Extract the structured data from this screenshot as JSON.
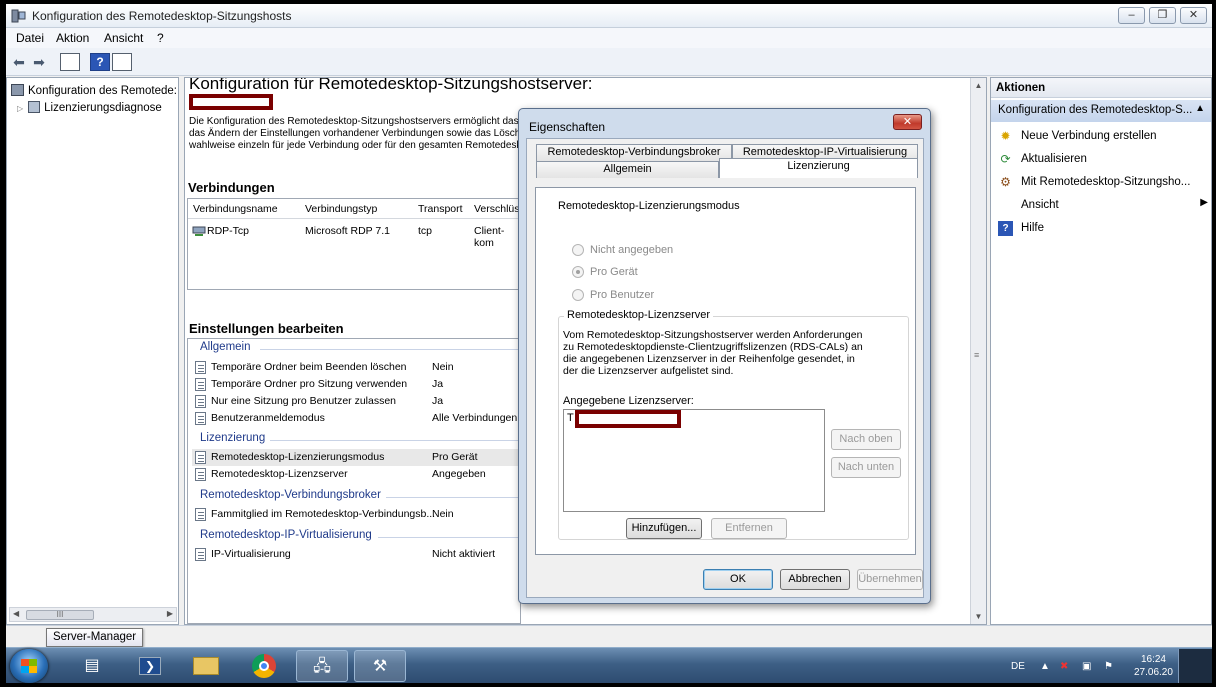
{
  "window": {
    "title": "Konfiguration des Remotedesktop-Sitzungshosts",
    "controls": {
      "minimize": "‒",
      "maximize": "❐",
      "close": "✕"
    }
  },
  "menu": [
    "Datei",
    "Aktion",
    "Ansicht",
    "?"
  ],
  "tree": {
    "root": "Konfiguration des Remotede:",
    "child": "Lizenzierungsdiagnose"
  },
  "center": {
    "title": "Konfiguration für Remotedesktop-Sitzungshostserver:",
    "description": [
      "Die Konfiguration des Remotedesktop-Sitzungshostservers ermöglicht das",
      "das Ändern der Einstellungen vorhandener Verbindungen sowie das Lösch",
      "wahlweise einzeln für jede Verbindung oder für den gesamten Remotedesk"
    ],
    "connections": {
      "heading": "Verbindungen",
      "columns": [
        "Verbindungsname",
        "Verbindungstyp",
        "Transport",
        "Verschlüss"
      ],
      "rows": [
        {
          "name": "RDP-Tcp",
          "type": "Microsoft RDP 7.1",
          "transport": "tcp",
          "encryption": "Client-kom"
        }
      ]
    },
    "settings": {
      "heading": "Einstellungen bearbeiten",
      "groups": [
        {
          "label": "Allgemein",
          "items": [
            {
              "name": "Temporäre Ordner beim Beenden löschen",
              "value": "Nein"
            },
            {
              "name": "Temporäre Ordner pro Sitzung verwenden",
              "value": "Ja"
            },
            {
              "name": "Nur eine Sitzung pro Benutzer zulassen",
              "value": "Ja"
            },
            {
              "name": "Benutzeranmeldemodus",
              "value": "Alle Verbindungen zu"
            }
          ]
        },
        {
          "label": "Lizenzierung",
          "items": [
            {
              "name": "Remotedesktop-Lizenzierungsmodus",
              "value": "Pro Gerät"
            },
            {
              "name": "Remotedesktop-Lizenzserver",
              "value": "Angegeben"
            }
          ]
        },
        {
          "label": "Remotedesktop-Verbindungsbroker",
          "items": [
            {
              "name": "Fammitglied im Remotedesktop-Verbindungsb...",
              "value": "Nein"
            }
          ]
        },
        {
          "label": "Remotedesktop-IP-Virtualisierung",
          "items": [
            {
              "name": "IP-Virtualisierung",
              "value": "Nicht aktiviert"
            }
          ]
        }
      ]
    }
  },
  "actions": {
    "title": "Aktionen",
    "section": "Konfiguration des Remotedesktop-S...",
    "items": [
      {
        "label": "Neue Verbindung erstellen",
        "icon": "new-connection-icon"
      },
      {
        "label": "Aktualisieren",
        "icon": "refresh-icon"
      },
      {
        "label": "Mit Remotedesktop-Sitzungsho...",
        "icon": "connect-icon"
      },
      {
        "label": "Ansicht",
        "icon": "none"
      },
      {
        "label": "Hilfe",
        "icon": "help-icon"
      }
    ]
  },
  "tooltip": "Server-Manager",
  "dialog": {
    "title": "Eigenschaften",
    "tabs_row1": [
      "Remotedesktop-Verbindungsbroker",
      "Remotedesktop-IP-Virtualisierung"
    ],
    "tabs_row2": [
      "Allgemein",
      "Lizenzierung"
    ],
    "active_tab": "Lizenzierung",
    "mode_label": "Remotedesktop-Lizenzierungsmodus",
    "radios": [
      {
        "label": "Nicht angegeben",
        "checked": false
      },
      {
        "label": "Pro Gerät",
        "checked": true
      },
      {
        "label": "Pro Benutzer",
        "checked": false
      }
    ],
    "server_group": {
      "legend": "Remotedesktop-Lizenzserver",
      "description": "Vom Remotedesktop-Sitzungshostserver werden Anforderungen zu Remotedesktopdienste-Clientzugriffslizenzen (RDS-CALs) an die angegebenen Lizenzserver in der Reihenfolge gesendet, in der die Lizenzserver aufgelistet sind.",
      "list_label": "Angegebene Lizenzserver:",
      "list_first_char": "T",
      "btn_up": "Nach oben",
      "btn_down": "Nach unten",
      "btn_add": "Hinzufügen...",
      "btn_remove": "Entfernen"
    },
    "btn_ok": "OK",
    "btn_cancel": "Abbrechen",
    "btn_apply": "Übernehmen"
  },
  "taskbar": {
    "language": "DE",
    "time": "16:24",
    "date": "27.06.20"
  },
  "colors": {
    "redaction": "#7a0000",
    "group_label": "#1f3a8a",
    "taskbar": "#3d5f85"
  }
}
